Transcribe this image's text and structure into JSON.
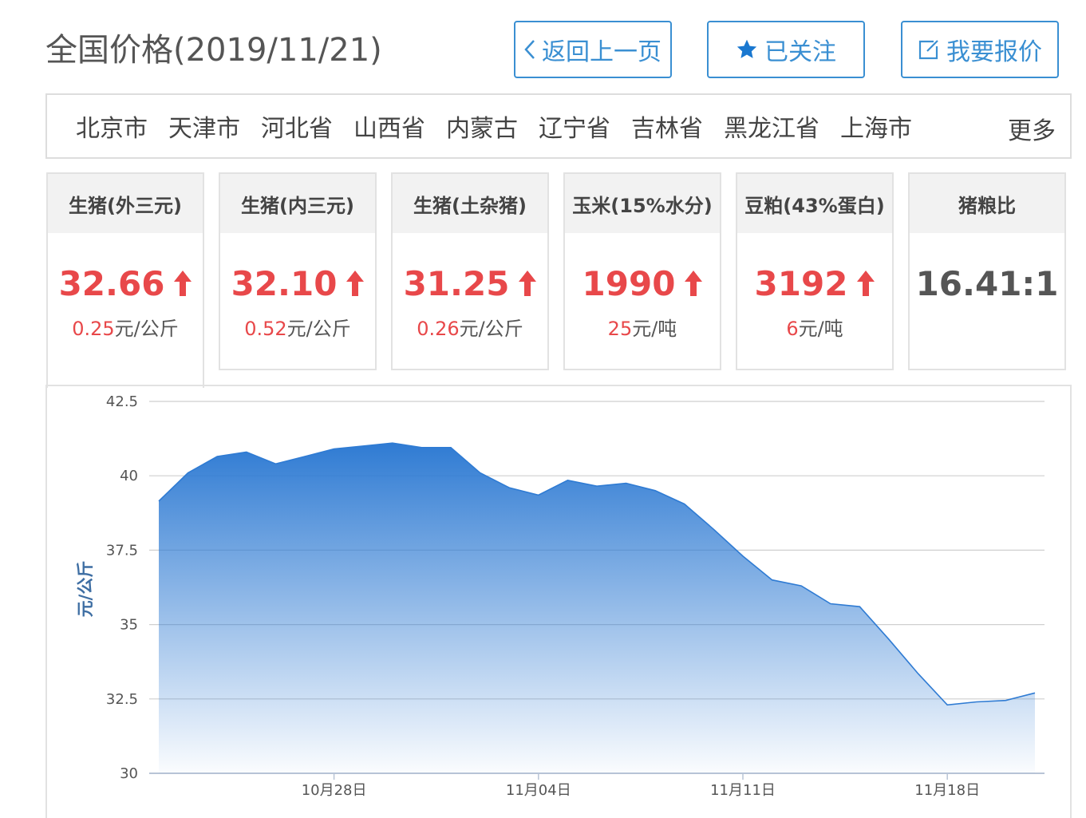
{
  "header": {
    "title": "全国价格(2019/11/21)",
    "back_label": "返回上一页",
    "follow_label": "已关注",
    "quote_label": "我要报价"
  },
  "regions": {
    "items": [
      "北京市",
      "天津市",
      "河北省",
      "山西省",
      "内蒙古",
      "辽宁省",
      "吉林省",
      "黑龙江省",
      "上海市"
    ],
    "more_label": "更多"
  },
  "cards": [
    {
      "name": "生猪(外三元)",
      "price": "32.66",
      "change": "0.25",
      "unit": "元/公斤",
      "trend": "up"
    },
    {
      "name": "生猪(内三元)",
      "price": "32.10",
      "change": "0.52",
      "unit": "元/公斤",
      "trend": "up"
    },
    {
      "name": "生猪(土杂猪)",
      "price": "31.25",
      "change": "0.26",
      "unit": "元/公斤",
      "trend": "up"
    },
    {
      "name": "玉米(15%水分)",
      "price": "1990",
      "change": "25",
      "unit": "元/吨",
      "trend": "up"
    },
    {
      "name": "豆粕(43%蛋白)",
      "price": "3192",
      "change": "6",
      "unit": "元/吨",
      "trend": "up"
    },
    {
      "name": "猪粮比",
      "price": "16.41:1",
      "change": "",
      "unit": "",
      "trend": "none"
    }
  ],
  "colors": {
    "accent": "#3a8fd2",
    "up": "#e8484a",
    "series_line": "#2f7bd3"
  },
  "chart_data": {
    "type": "area",
    "x": [
      "10/22",
      "10/23",
      "10/24",
      "10/25",
      "10/26",
      "10/27",
      "10/28",
      "10/29",
      "10/30",
      "10/31",
      "11/01",
      "11/02",
      "11/03",
      "11/04",
      "11/05",
      "11/06",
      "11/07",
      "11/08",
      "11/09",
      "11/10",
      "11/11",
      "11/12",
      "11/13",
      "11/14",
      "11/15",
      "11/16",
      "11/17",
      "11/18",
      "11/19",
      "11/20",
      "11/21"
    ],
    "series": [
      {
        "values": [
          39.15,
          40.1,
          40.65,
          40.8,
          40.4,
          40.65,
          40.9,
          41.0,
          41.1,
          40.95,
          40.95,
          40.1,
          39.6,
          39.35,
          39.85,
          39.65,
          39.75,
          39.5,
          39.05,
          38.2,
          37.3,
          36.5,
          36.3,
          35.7,
          35.6,
          34.5,
          33.35,
          32.3,
          32.4,
          32.45,
          32.7
        ]
      }
    ],
    "x_ticks": [
      "10月28日",
      "11月04日",
      "11月11日",
      "11月18日"
    ],
    "x_tick_index": [
      6,
      13,
      20,
      27
    ],
    "ylabel": "元/公斤",
    "ylim": [
      30,
      42.5
    ],
    "y_ticks": [
      "30",
      "32.5",
      "35",
      "37.5",
      "40",
      "42.5"
    ],
    "grid": true
  }
}
